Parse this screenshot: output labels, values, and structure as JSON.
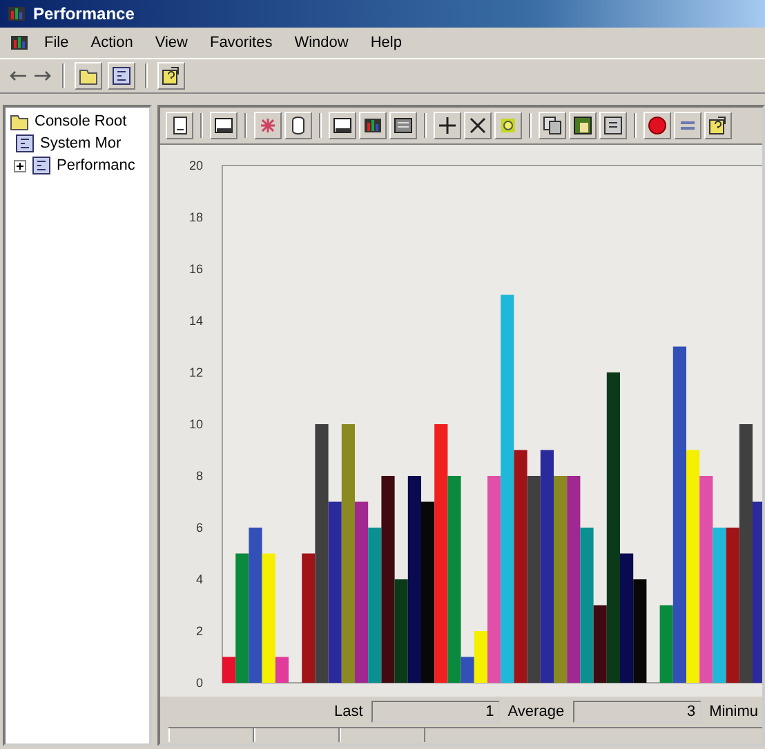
{
  "window": {
    "title": "Performance"
  },
  "menu": [
    "File",
    "Action",
    "View",
    "Favorites",
    "Window",
    "Help"
  ],
  "tree": [
    {
      "label": "Console Root",
      "children": [
        {
          "label": "System Mor"
        },
        {
          "label": "Performanc",
          "expanded": false
        }
      ]
    }
  ],
  "chart_data": {
    "type": "bar",
    "ylim": [
      0,
      20
    ],
    "yticks": [
      0,
      2,
      4,
      6,
      8,
      10,
      12,
      14,
      16,
      18,
      20
    ],
    "series": [
      {
        "color": "#e8102c",
        "values": [
          1
        ]
      },
      {
        "color": "#0a8a3c",
        "values": [
          5
        ]
      },
      {
        "color": "#3350b8",
        "values": [
          6
        ]
      },
      {
        "color": "#f5f000",
        "values": [
          5
        ]
      },
      {
        "color": "#e03c9c",
        "values": [
          1
        ]
      },
      {
        "values": [
          null
        ]
      },
      {
        "color": "#a01418",
        "values": [
          5
        ]
      },
      {
        "color": "#404040",
        "values": [
          10
        ]
      },
      {
        "color": "#2a2a9c",
        "values": [
          7
        ]
      },
      {
        "color": "#8a8a20",
        "values": [
          10
        ]
      },
      {
        "color": "#a02890",
        "values": [
          7
        ]
      },
      {
        "color": "#0a9090",
        "values": [
          6
        ]
      },
      {
        "color": "#400a10",
        "values": [
          8
        ]
      },
      {
        "color": "#0a3a18",
        "values": [
          4
        ]
      },
      {
        "color": "#0a0a50",
        "values": [
          8
        ]
      },
      {
        "color": "#080808",
        "values": [
          7
        ]
      },
      {
        "color": "#f02020",
        "values": [
          10
        ]
      },
      {
        "color": "#0a8a3c",
        "values": [
          8
        ]
      },
      {
        "color": "#3350b8",
        "values": [
          1
        ]
      },
      {
        "color": "#f5f000",
        "values": [
          2
        ]
      },
      {
        "color": "#e050a8",
        "values": [
          8
        ]
      },
      {
        "color": "#20b8d8",
        "values": [
          15
        ]
      },
      {
        "color": "#a01418",
        "values": [
          9
        ]
      },
      {
        "color": "#404040",
        "values": [
          8
        ]
      },
      {
        "color": "#2a2a9c",
        "values": [
          9
        ]
      },
      {
        "color": "#8a8a20",
        "values": [
          8
        ]
      },
      {
        "color": "#a02890",
        "values": [
          8
        ]
      },
      {
        "color": "#0a9090",
        "values": [
          6
        ]
      },
      {
        "color": "#400a10",
        "values": [
          3
        ]
      },
      {
        "color": "#0a3a18",
        "values": [
          12
        ]
      },
      {
        "color": "#0a0a50",
        "values": [
          5
        ]
      },
      {
        "color": "#080808",
        "values": [
          4
        ]
      },
      {
        "values": [
          null
        ]
      },
      {
        "color": "#0a8a3c",
        "values": [
          3
        ]
      },
      {
        "color": "#3350b8",
        "values": [
          13
        ]
      },
      {
        "color": "#f5f000",
        "values": [
          9
        ]
      },
      {
        "color": "#e050a8",
        "values": [
          8
        ]
      },
      {
        "color": "#20b8d8",
        "values": [
          6
        ]
      },
      {
        "color": "#a01418",
        "values": [
          6
        ]
      },
      {
        "color": "#404040",
        "values": [
          10
        ]
      },
      {
        "color": "#2a2a9c",
        "values": [
          7
        ]
      }
    ]
  },
  "stats": [
    {
      "label": "Last",
      "value": "1"
    },
    {
      "label": "Average",
      "value": "3"
    },
    {
      "label": "Minimu"
    }
  ]
}
